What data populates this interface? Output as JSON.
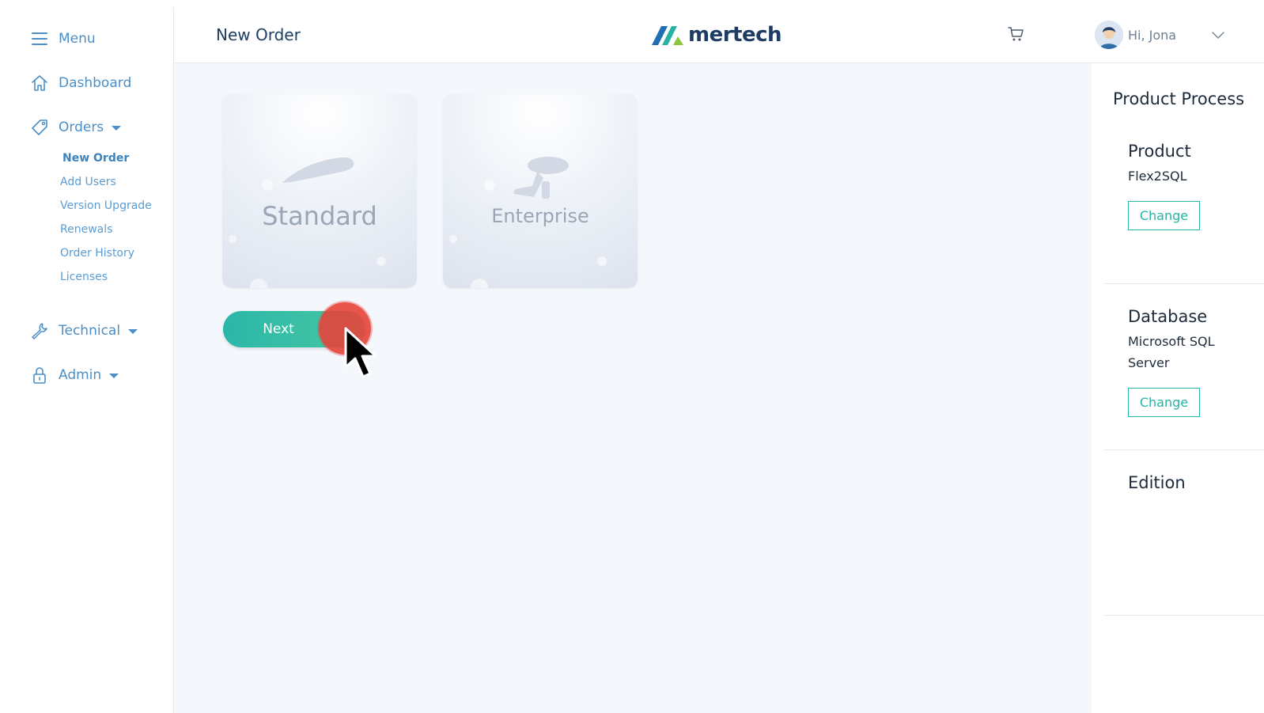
{
  "sidebar": {
    "menu_label": "Menu",
    "items": [
      {
        "label": "Dashboard",
        "icon": "home-icon"
      },
      {
        "label": "Orders",
        "icon": "tag-icon",
        "expanded": true
      },
      {
        "label": "Technical",
        "icon": "wrench-icon"
      },
      {
        "label": "Admin",
        "icon": "lock-icon"
      }
    ],
    "orders_sub": [
      "New Order",
      "Add Users",
      "Version Upgrade",
      "Renewals",
      "Order History",
      "Licenses"
    ],
    "active_sub": "New Order"
  },
  "header": {
    "title": "New Order",
    "logo_text": "mertech",
    "greeting": "Hi, Jona"
  },
  "main": {
    "cards": [
      {
        "label": "Standard"
      },
      {
        "label": "Enterprise"
      }
    ],
    "next_label": "Next"
  },
  "panel": {
    "title": "Product Process",
    "sections": [
      {
        "heading": "Product",
        "value": "Flex2SQL",
        "button": "Change"
      },
      {
        "heading": "Database",
        "value": "Microsoft SQL Server",
        "button": "Change"
      },
      {
        "heading": "Edition",
        "value": "",
        "button": ""
      }
    ]
  },
  "colors": {
    "accent": "#27b3a3",
    "nav": "#4a8fc7",
    "click_indicator": "#e6423a"
  }
}
